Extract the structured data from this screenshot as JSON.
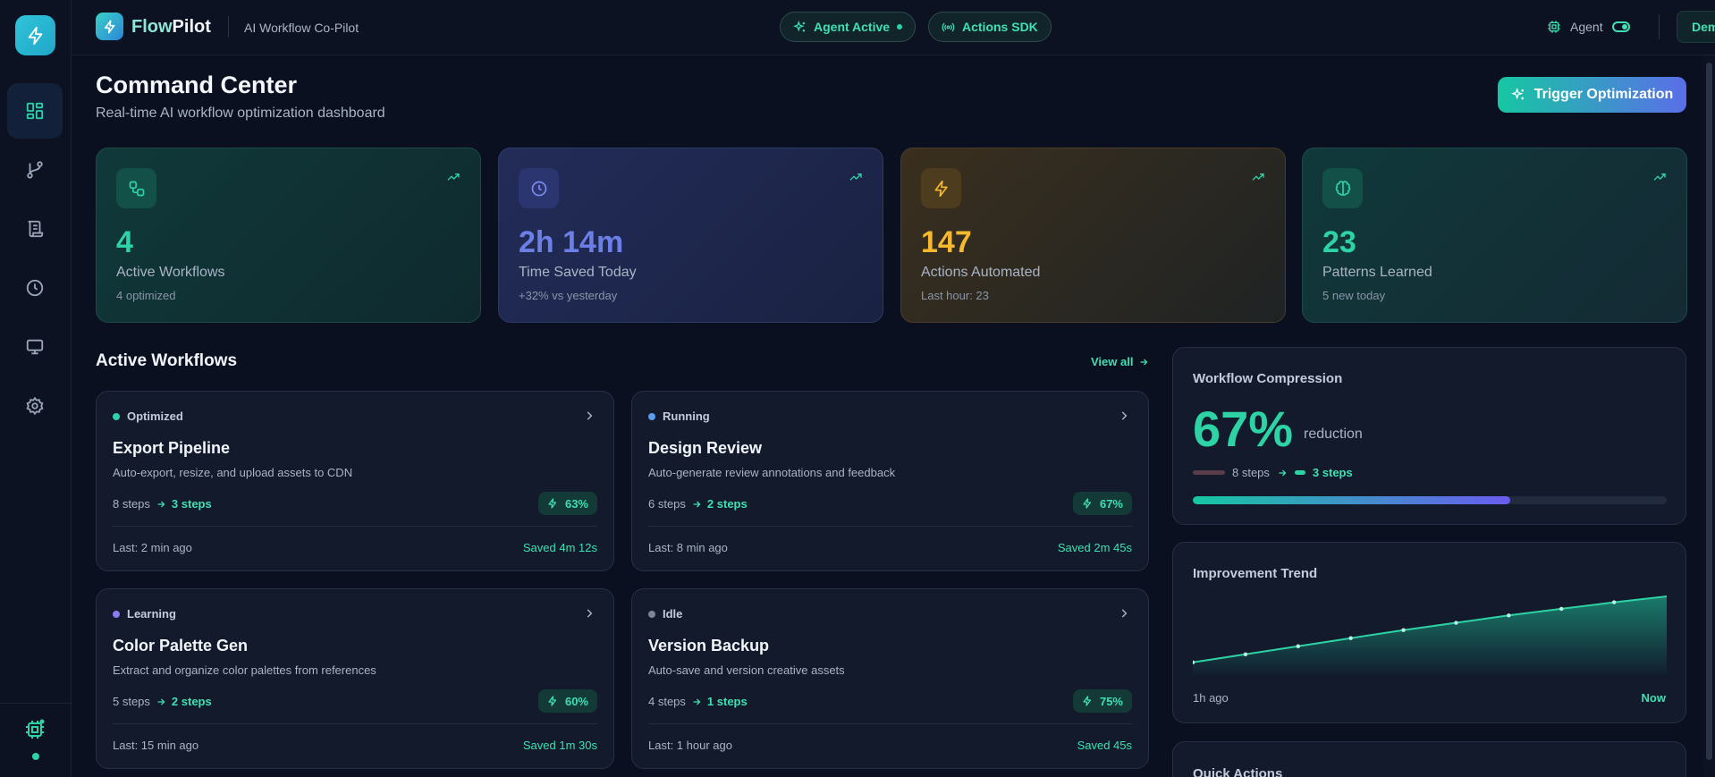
{
  "brand": {
    "name_a": "Flow",
    "name_b": "Pilot",
    "subtitle": "AI Workflow Co-Pilot"
  },
  "topbar": {
    "agent_active": "Agent Active",
    "actions_sdk": "Actions SDK",
    "agent_label": "Agent",
    "demo_label": "Demo"
  },
  "sidebar": {
    "items": [
      {
        "icon": "dashboard-icon",
        "active": true
      },
      {
        "icon": "git-branch-icon",
        "active": false
      },
      {
        "icon": "scroll-icon",
        "active": false
      },
      {
        "icon": "clock-icon",
        "active": false
      },
      {
        "icon": "monitor-icon",
        "active": false
      },
      {
        "icon": "gear-icon",
        "active": false
      }
    ]
  },
  "header": {
    "title": "Command Center",
    "subtitle": "Real-time AI workflow optimization dashboard",
    "trigger_label": "Trigger Optimization"
  },
  "stats": [
    {
      "icon": "workflow-icon",
      "value": "4",
      "label": "Active Workflows",
      "sub": "4 optimized",
      "color": "#2ed3a5"
    },
    {
      "icon": "clock-icon",
      "value": "2h 14m",
      "label": "Time Saved Today",
      "sub": "+32% vs yesterday",
      "color": "#6b7fe6"
    },
    {
      "icon": "bolt-icon",
      "value": "147",
      "label": "Actions Automated",
      "sub": "Last hour: 23",
      "color": "#f5b82e"
    },
    {
      "icon": "brain-icon",
      "value": "23",
      "label": "Patterns Learned",
      "sub": "5 new today",
      "color": "#2ed3a5"
    }
  ],
  "workflows_section": {
    "title": "Active Workflows",
    "view_all": "View all"
  },
  "workflows": [
    {
      "status": "Optimized",
      "status_color": "#2ed3a5",
      "title": "Export Pipeline",
      "desc": "Auto-export, resize, and upload assets to CDN",
      "from": "8 steps",
      "to": "3 steps",
      "badge": "63%",
      "last": "Last: 2 min ago",
      "saved": "Saved 4m 12s"
    },
    {
      "status": "Running",
      "status_color": "#5b9cf0",
      "title": "Design Review",
      "desc": "Auto-generate review annotations and feedback",
      "from": "6 steps",
      "to": "2 steps",
      "badge": "67%",
      "last": "Last: 8 min ago",
      "saved": "Saved 2m 45s"
    },
    {
      "status": "Learning",
      "status_color": "#8a7cf0",
      "title": "Color Palette Gen",
      "desc": "Extract and organize color palettes from references",
      "from": "5 steps",
      "to": "2 steps",
      "badge": "60%",
      "last": "Last: 15 min ago",
      "saved": "Saved 1m 30s"
    },
    {
      "status": "Idle",
      "status_color": "#7c8698",
      "title": "Version Backup",
      "desc": "Auto-save and version creative assets",
      "from": "4 steps",
      "to": "1 steps",
      "badge": "75%",
      "last": "Last: 1 hour ago",
      "saved": "Saved 45s"
    }
  ],
  "compression": {
    "title": "Workflow Compression",
    "value": "67%",
    "unit": "reduction",
    "from": "8 steps",
    "to": "3 steps",
    "progress": 0.67
  },
  "trend": {
    "title": "Improvement Trend",
    "from_label": "1h ago",
    "to_label": "Now",
    "points": [
      0.1,
      0.21,
      0.32,
      0.43,
      0.54,
      0.64,
      0.74,
      0.83,
      0.92,
      1.0
    ]
  },
  "quick_actions": {
    "title": "Quick Actions"
  }
}
